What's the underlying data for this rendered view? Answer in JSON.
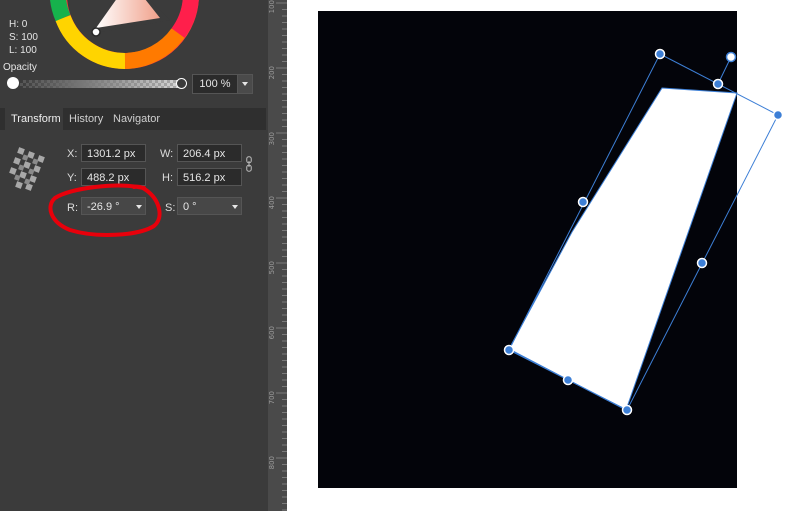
{
  "color": {
    "h_label": "H: 0",
    "s_label": "S: 100",
    "l_label": "L: 100",
    "opacity_label": "Opacity",
    "opacity_value": "100 %",
    "opacity_level": 1.0
  },
  "tabs": [
    {
      "label": "Transform",
      "active": true
    },
    {
      "label": "History",
      "active": false
    },
    {
      "label": "Navigator",
      "active": false
    }
  ],
  "transform": {
    "x_label": "X:",
    "x_value": "1301.2 px",
    "y_label": "Y:",
    "y_value": "488.2 px",
    "w_label": "W:",
    "w_value": "206.4 px",
    "h_label": "H:",
    "h_value": "516.2 px",
    "r_label": "R:",
    "r_value": "-26.9 °",
    "s_label": "S:",
    "s_value": "0 °"
  },
  "ruler": {
    "labels": [
      "100",
      "200",
      "300",
      "400",
      "500",
      "600",
      "700",
      "800"
    ]
  },
  "colors": {
    "panel": "#3b3b3b",
    "selection": "#3d7fd6",
    "annotation": "#e8000b",
    "artboard": "#03040a"
  }
}
